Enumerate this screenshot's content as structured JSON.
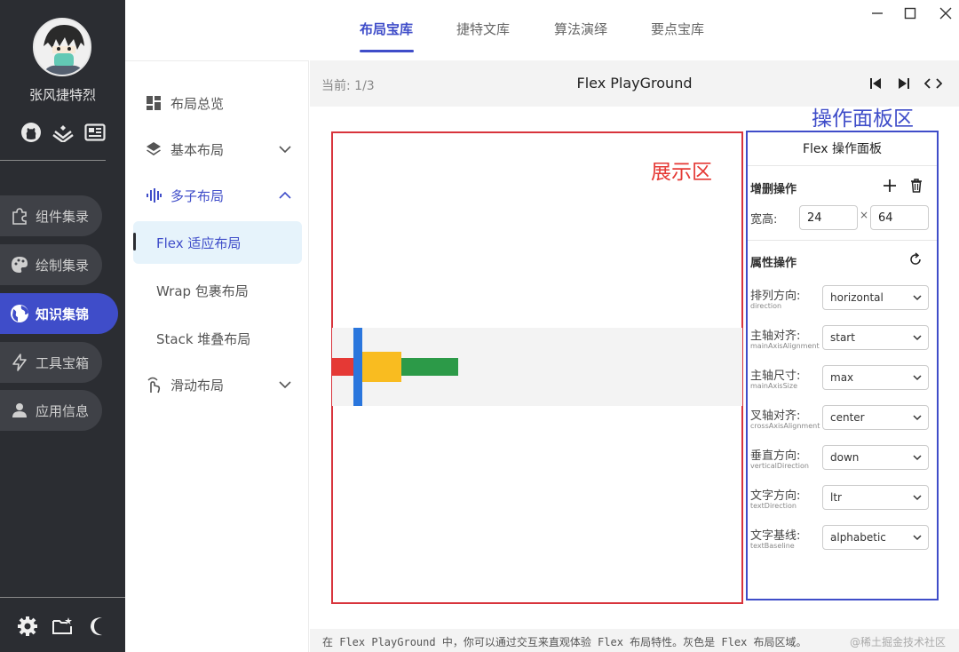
{
  "user": {
    "name": "张风捷特烈"
  },
  "rail": {
    "icons": [
      "github-icon",
      "juejin-icon",
      "article-icon"
    ],
    "items": [
      {
        "label": "组件集录",
        "icon": "puzzle-icon",
        "active": false
      },
      {
        "label": "绘制集录",
        "icon": "palette-icon",
        "active": false
      },
      {
        "label": "知识集锦",
        "icon": "globe-icon",
        "active": true
      },
      {
        "label": "工具宝箱",
        "icon": "bolt-icon",
        "active": false
      },
      {
        "label": "应用信息",
        "icon": "person-icon",
        "active": false
      }
    ],
    "bottom_icons": [
      "gear-icon",
      "folder-star-icon",
      "moon-icon"
    ]
  },
  "tabs": [
    {
      "label": "布局宝库",
      "active": true
    },
    {
      "label": "捷特文库",
      "active": false
    },
    {
      "label": "算法演绎",
      "active": false
    },
    {
      "label": "要点宝库",
      "active": false
    }
  ],
  "subnav": [
    {
      "label": "布局总览",
      "icon": "dashboard-icon"
    },
    {
      "label": "基本布局",
      "icon": "layers-icon"
    },
    {
      "label": "多子布局",
      "icon": "waveform-icon"
    },
    {
      "label": "Flex 适应布局"
    },
    {
      "label": "Wrap 包裹布局"
    },
    {
      "label": "Stack 堆叠布局"
    },
    {
      "label": "滑动布局",
      "icon": "swipe-icon"
    }
  ],
  "content": {
    "counter": "当前: 1/3",
    "title": "Flex PlayGround",
    "display_label": "展示区",
    "panel_label": "操作面板区"
  },
  "flex_children": [
    {
      "color": "#e53935",
      "width": 24,
      "height": 20
    },
    {
      "color": "#2a76dd",
      "width": 10,
      "height": 88
    },
    {
      "color": "#f9bc20",
      "width": 44,
      "height": 34
    },
    {
      "color": "#2c9a48",
      "width": 64,
      "height": 20
    }
  ],
  "panel": {
    "title": "Flex 操作面板",
    "edit_title": "增删操作",
    "size_label": "宽高:",
    "width": "24",
    "times": "×",
    "height": "64",
    "props_title": "属性操作",
    "properties": [
      {
        "label": "排列方向:",
        "sub": "direction",
        "value": "horizontal"
      },
      {
        "label": "主轴对齐:",
        "sub": "mainAxisAlignment",
        "value": "start"
      },
      {
        "label": "主轴尺寸:",
        "sub": "mainAxisSize",
        "value": "max"
      },
      {
        "label": "叉轴对齐:",
        "sub": "crossAxisAlignment",
        "value": "center"
      },
      {
        "label": "垂直方向:",
        "sub": "verticalDirection",
        "value": "down"
      },
      {
        "label": "文字方向:",
        "sub": "textDirection",
        "value": "ltr"
      },
      {
        "label": "文字基线:",
        "sub": "textBaseline",
        "value": "alphabetic"
      }
    ]
  },
  "footer": {
    "text": "在 Flex PlayGround 中，你可以通过交互来直观体验 Flex 布局特性。灰色是 Flex 布局区域。",
    "watermark": "@稀土掘金技术社区"
  }
}
